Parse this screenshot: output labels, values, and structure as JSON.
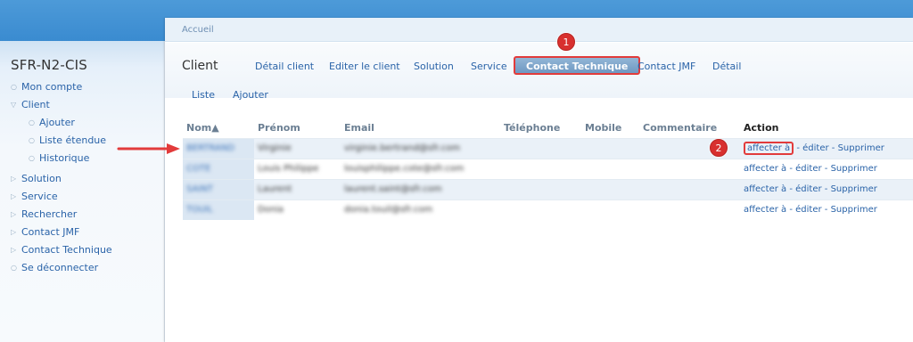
{
  "app": {
    "title": "SFR-N2-CIS"
  },
  "breadcrumb": "Accueil",
  "sidebar": {
    "items": [
      {
        "label": "Mon compte",
        "bullet": "○"
      },
      {
        "label": "Client",
        "bullet": "▽"
      },
      {
        "label": "Ajouter",
        "bullet": "○"
      },
      {
        "label": "Liste étendue",
        "bullet": "○"
      },
      {
        "label": "Historique",
        "bullet": "○"
      },
      {
        "label": "Solution",
        "bullet": "▷"
      },
      {
        "label": "Service",
        "bullet": "▷"
      },
      {
        "label": "Rechercher",
        "bullet": "▷"
      },
      {
        "label": "Contact JMF",
        "bullet": "▷"
      },
      {
        "label": "Contact Technique",
        "bullet": "▷"
      },
      {
        "label": "Se déconnecter",
        "bullet": "○"
      }
    ]
  },
  "page": {
    "title": "Client",
    "tabs": [
      {
        "label": "Détail client"
      },
      {
        "label": "Editer le client"
      },
      {
        "label": "Solution"
      },
      {
        "label": "Service"
      },
      {
        "label": "Contact Technique",
        "active": true
      },
      {
        "label": "Contact JMF"
      },
      {
        "label": "Détail"
      }
    ],
    "subtabs": [
      {
        "label": "Liste"
      },
      {
        "label": "Ajouter"
      }
    ]
  },
  "table": {
    "columns": [
      "Nom▲",
      "Prénom",
      "Email",
      "Téléphone",
      "Mobile",
      "Commentaire",
      "Action"
    ],
    "rows": [
      {
        "nom": "BERTRAND",
        "prenom": "Virginie",
        "email": "virginie.bertrand@sfr.com",
        "telephone": "",
        "mobile": "",
        "commentaire": "",
        "blurred": true
      },
      {
        "nom": "COTE",
        "prenom": "Louis Philippe",
        "email": "louisphilippe.cote@sfr.com",
        "telephone": "",
        "mobile": "",
        "commentaire": "",
        "blurred": true
      },
      {
        "nom": "SAINT",
        "prenom": "Laurent",
        "email": "laurent.saint@sfr.com",
        "telephone": "",
        "mobile": "",
        "commentaire": "",
        "blurred": true
      },
      {
        "nom": "TOUIL",
        "prenom": "Donia",
        "email": "donia.touil@sfr.com",
        "telephone": "",
        "mobile": "",
        "commentaire": "",
        "blurred": true
      }
    ],
    "actions": {
      "affecter": "affecter à",
      "editer": "éditer",
      "supprimer": "Supprimer",
      "separator": " - "
    }
  },
  "annotations": {
    "marker1": "1",
    "marker2": "2"
  },
  "colors": {
    "topbar": "#3a8bd0",
    "link": "#2a63a8",
    "highlight": "#e23b3b",
    "marker": "#d8302f"
  }
}
